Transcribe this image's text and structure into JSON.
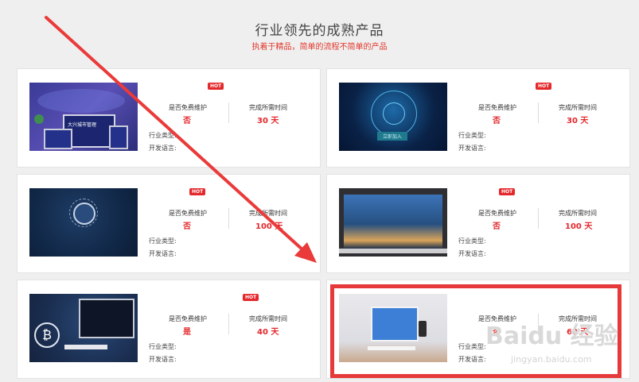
{
  "header": {
    "title": "行业领先的成熟产品",
    "subtitle": "执着于精品，简单的流程不简单的产品"
  },
  "labels": {
    "hot": "HOT",
    "maintenance": "是否免费维护",
    "time": "完成所需时间",
    "industry": "行业类型:",
    "language": "开发语言:"
  },
  "products": [
    {
      "maintenance": "否",
      "time": "30 天"
    },
    {
      "maintenance": "否",
      "time": "30 天"
    },
    {
      "maintenance": "否",
      "time": "100 天"
    },
    {
      "maintenance": "否",
      "time": "100 天"
    },
    {
      "maintenance": "是",
      "time": "40 天"
    },
    {
      "maintenance": "否",
      "time": "60 天"
    }
  ],
  "thumbs": {
    "card1_logo": "大兴城市管理",
    "card2_button": "立即加入"
  },
  "watermark": {
    "brand": "Baidu 经验",
    "url": "jingyan.baidu.com"
  },
  "colors": {
    "accent": "#e4282c",
    "highlight": "#e5393a"
  }
}
